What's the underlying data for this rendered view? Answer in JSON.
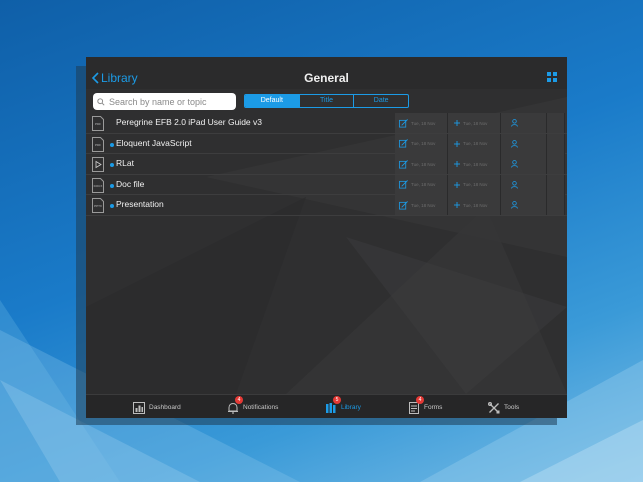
{
  "colors": {
    "accent": "#1c9be6",
    "badge": "#e53935",
    "panel": "#2f2f30"
  },
  "navbar": {
    "back_label": "Library",
    "title": "General",
    "grid_icon": "grid-icon"
  },
  "search": {
    "placeholder": "Search by name or topic",
    "value": ""
  },
  "sort": {
    "options": [
      "Default",
      "Title",
      "Date"
    ],
    "selected": "Default"
  },
  "documents": [
    {
      "title": "Peregrine EFB 2.0 iPad User Guide v3",
      "icon": "pdf-file-icon",
      "icon_text": "PDF",
      "unread": false,
      "modified": "Tue, 18 Nov",
      "added": "Tue, 18 Nov"
    },
    {
      "title": "Eloquent JavaScript",
      "icon": "pdf-file-icon",
      "icon_text": "PDF",
      "unread": true,
      "modified": "Tue, 18 Nov",
      "added": "Tue, 18 Nov"
    },
    {
      "title": "RLat",
      "icon": "video-file-icon",
      "icon_text": "",
      "unread": true,
      "modified": "Tue, 18 Nov",
      "added": "Tue, 18 Nov"
    },
    {
      "title": "Doc file",
      "icon": "word-file-icon",
      "icon_text": "DOCX",
      "unread": true,
      "modified": "Tue, 18 Nov",
      "added": "Tue, 18 Nov"
    },
    {
      "title": "Presentation",
      "icon": "ppt-file-icon",
      "icon_text": "PPTX",
      "unread": true,
      "modified": "Tue, 18 Nov",
      "added": "Tue, 18 Nov"
    }
  ],
  "tabbar": {
    "items": [
      {
        "label": "Dashboard",
        "icon": "dashboard-icon",
        "badge": null,
        "active": false
      },
      {
        "label": "Notifications",
        "icon": "bell-icon",
        "badge": "4",
        "active": false
      },
      {
        "label": "Library",
        "icon": "library-icon",
        "badge": "5",
        "active": true
      },
      {
        "label": "Forms",
        "icon": "forms-icon",
        "badge": "4",
        "active": false
      },
      {
        "label": "Tools",
        "icon": "tools-icon",
        "badge": null,
        "active": false
      }
    ]
  }
}
